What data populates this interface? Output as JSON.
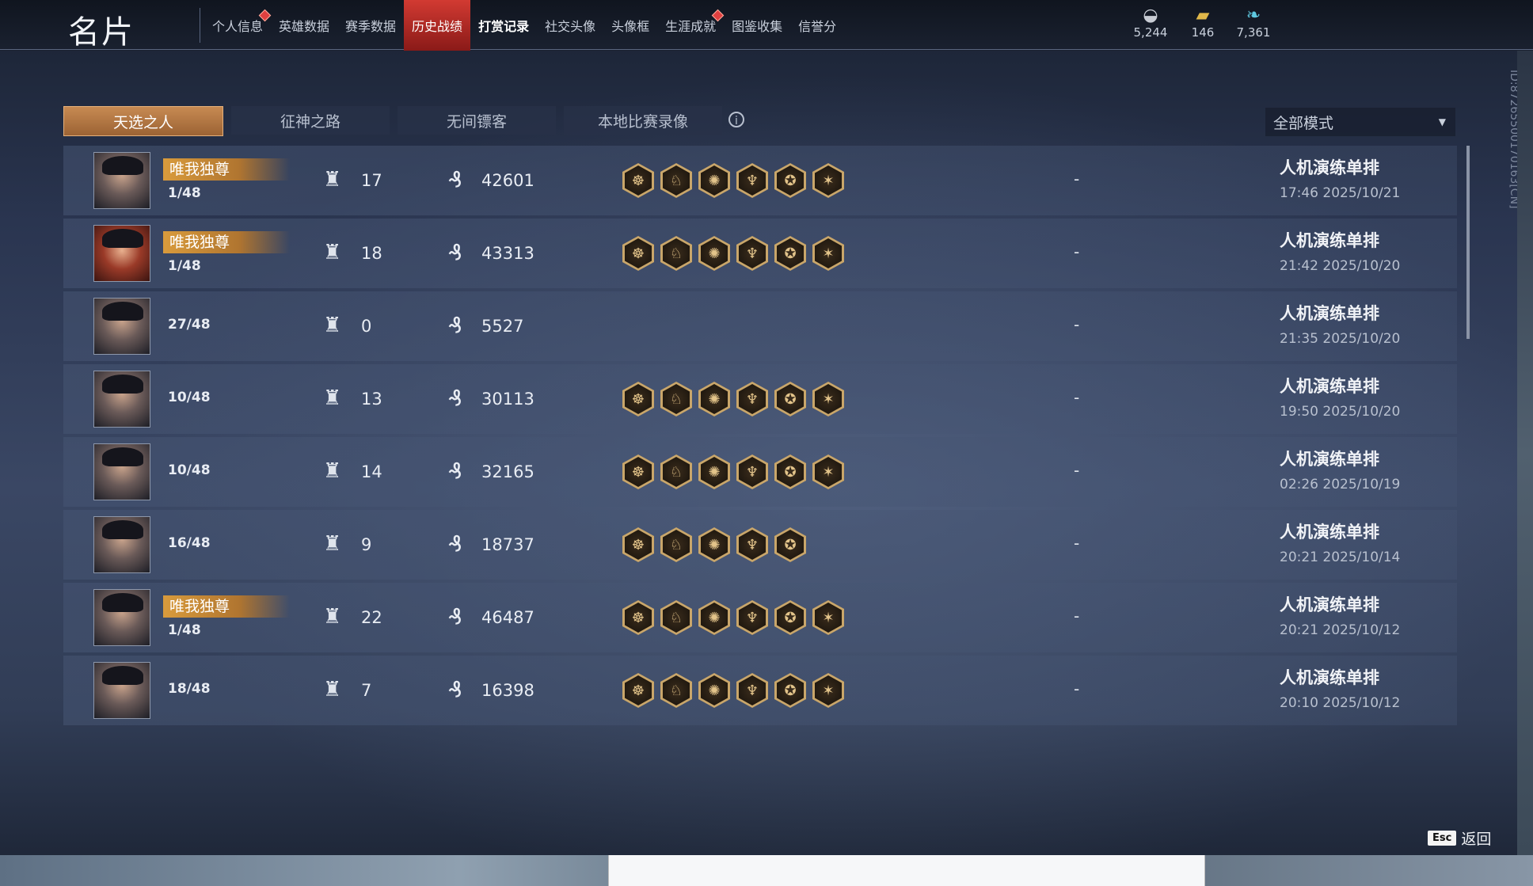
{
  "header": {
    "title": "名片",
    "nav": [
      {
        "label": "个人信息",
        "dot": true
      },
      {
        "label": "英雄数据",
        "dot": false
      },
      {
        "label": "赛季数据",
        "dot": false
      },
      {
        "label": "历史战绩",
        "dot": false,
        "active": true
      },
      {
        "label": "打赏记录",
        "dot": false,
        "bold": true
      },
      {
        "label": "社交头像",
        "dot": false
      },
      {
        "label": "头像框",
        "dot": false
      },
      {
        "label": "生涯成就",
        "dot": true
      },
      {
        "label": "图鉴收集",
        "dot": false
      },
      {
        "label": "信誉分",
        "dot": false
      }
    ],
    "currencies": [
      {
        "icon": "coin-icon",
        "value": "5,244"
      },
      {
        "icon": "ticket-icon",
        "value": "146"
      },
      {
        "icon": "feather-icon",
        "value": "7,361"
      }
    ]
  },
  "filters": {
    "tabs": [
      "天选之人",
      "征神之路",
      "无间镖客",
      "本地比赛录像"
    ],
    "active_tab": 0,
    "mode_select": "全部模式"
  },
  "records": [
    {
      "badge": "唯我独尊",
      "rank": "1/48",
      "kills": "17",
      "gold": "42601",
      "icons": 6,
      "extra": "-",
      "mode": "人机演练单排",
      "time": "17:46  2025/10/21",
      "avatar": "default"
    },
    {
      "badge": "唯我独尊",
      "rank": "1/48",
      "kills": "18",
      "gold": "43313",
      "icons": 6,
      "extra": "-",
      "mode": "人机演练单排",
      "time": "21:42  2025/10/20",
      "avatar": "red"
    },
    {
      "badge": "",
      "rank": "27/48",
      "kills": "0",
      "gold": "5527",
      "icons": 0,
      "extra": "-",
      "mode": "人机演练单排",
      "time": "21:35  2025/10/20",
      "avatar": "default"
    },
    {
      "badge": "",
      "rank": "10/48",
      "kills": "13",
      "gold": "30113",
      "icons": 6,
      "extra": "-",
      "mode": "人机演练单排",
      "time": "19:50  2025/10/20",
      "avatar": "default"
    },
    {
      "badge": "",
      "rank": "10/48",
      "kills": "14",
      "gold": "32165",
      "icons": 6,
      "extra": "-",
      "mode": "人机演练单排",
      "time": "02:26  2025/10/19",
      "avatar": "default"
    },
    {
      "badge": "",
      "rank": "16/48",
      "kills": "9",
      "gold": "18737",
      "icons": 5,
      "extra": "-",
      "mode": "人机演练单排",
      "time": "20:21  2025/10/14",
      "avatar": "default"
    },
    {
      "badge": "唯我独尊",
      "rank": "1/48",
      "kills": "22",
      "gold": "46487",
      "icons": 6,
      "extra": "-",
      "mode": "人机演练单排",
      "time": "20:21  2025/10/12",
      "avatar": "default"
    },
    {
      "badge": "",
      "rank": "18/48",
      "kills": "7",
      "gold": "16398",
      "icons": 6,
      "extra": "-",
      "mode": "人机演练单排",
      "time": "20:10  2025/10/12",
      "avatar": "default"
    }
  ],
  "side_id": "ID:8726550017016​3[CN]",
  "footer": {
    "esc_key": "Esc",
    "back_label": "返回"
  }
}
